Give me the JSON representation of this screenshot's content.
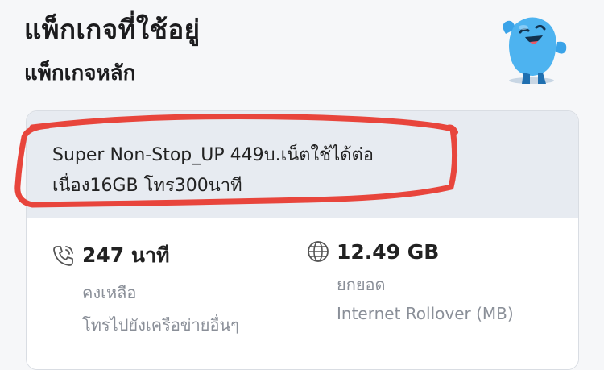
{
  "header": {
    "title": "แพ็กเกจที่ใช้อยู่",
    "subtitle": "แพ็กเกจหลัก"
  },
  "mascot": {
    "icon": "mascot-icon"
  },
  "package": {
    "name": "Super Non-Stop_UP 449บ.เน็ตใช้ได้ต่อเนื่อง16GB โทร300นาที"
  },
  "stats": {
    "voice": {
      "value": "247 นาที",
      "label1": "คงเหลือ",
      "label2": "โทรไปยังเครือข่ายอื่นๆ",
      "icon": "phone-icon"
    },
    "data": {
      "value": "12.49 GB",
      "label1": "ยกยอด",
      "label2": "Internet Rollover (MB)",
      "icon": "globe-icon"
    }
  },
  "colors": {
    "highlight": "#e8453c",
    "card_header": "#e7ebf1",
    "mascot": "#3aa3e8"
  }
}
